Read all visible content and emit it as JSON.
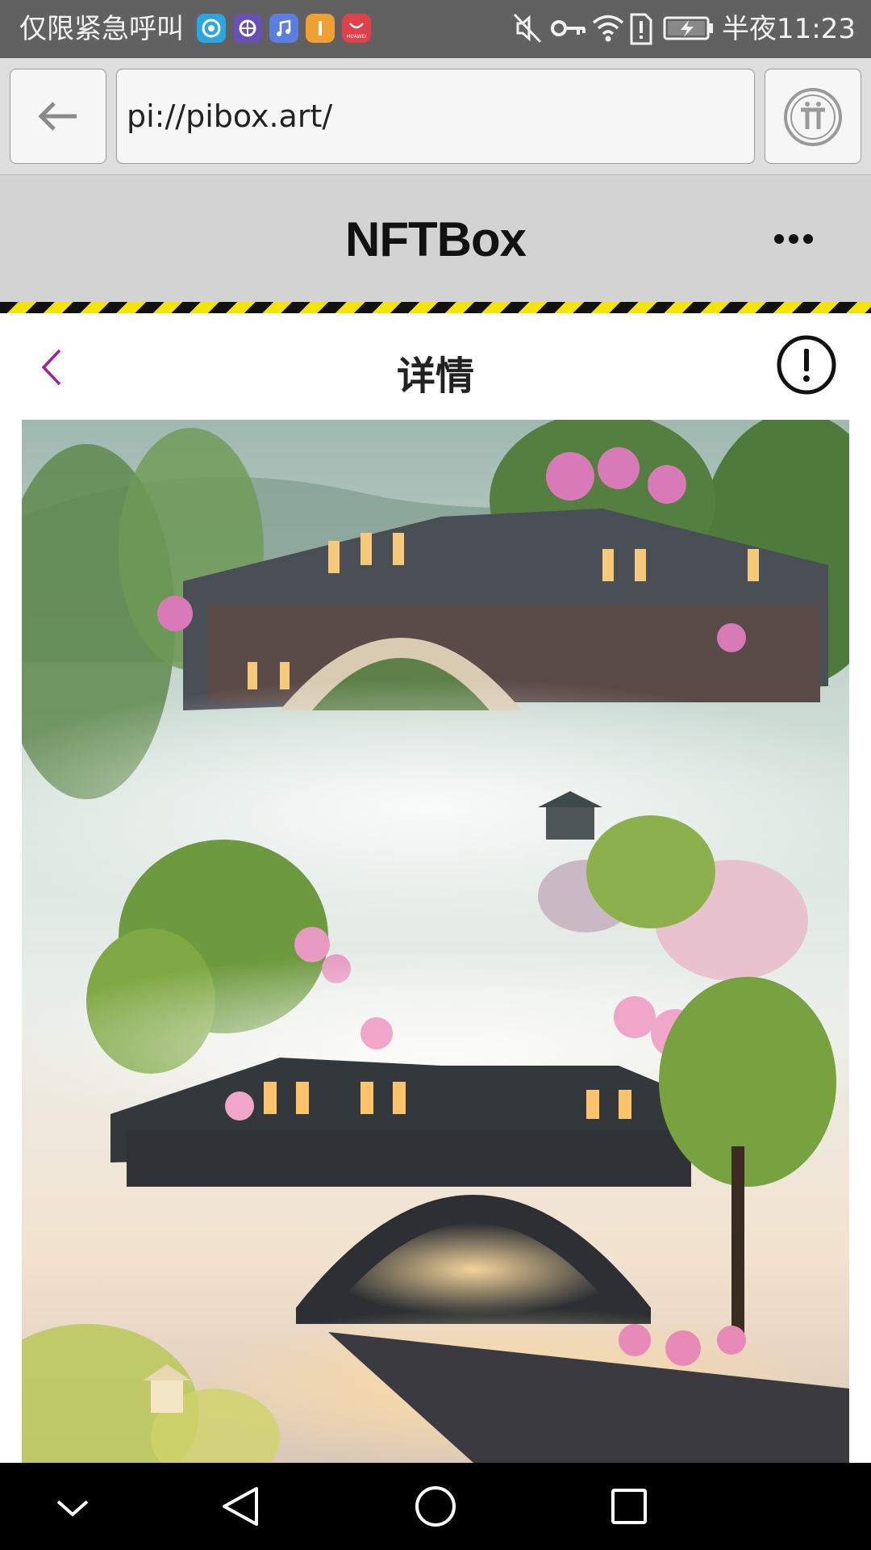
{
  "status_bar": {
    "carrier_text": "仅限紧急呼叫",
    "time": "半夜11:23",
    "app_icons": [
      "sina-weibo-icon",
      "purple-app-icon",
      "music-icon",
      "orange-app-icon",
      "huawei-store-icon"
    ],
    "status_icons": [
      "mute-icon",
      "key-icon",
      "wifi-icon",
      "sim-alert-icon",
      "battery-charging-icon"
    ],
    "huawei_label": "HUAWEI"
  },
  "browser": {
    "url": "pi://pibox.art/",
    "back_icon": "arrow-left-icon",
    "pi_icon": "pi-logo-icon"
  },
  "app_header": {
    "title": "NFTBox",
    "menu_icon": "more-horizontal-icon"
  },
  "detail": {
    "title": "详情",
    "back_icon": "chevron-left-icon",
    "info_icon": "exclamation-circle-icon",
    "accent_color": "#a020a0"
  },
  "artwork": {
    "description_icon": "nft-artwork-image"
  },
  "nav_bar": {
    "icons": [
      "chevron-down-icon",
      "back-triangle-icon",
      "home-circle-icon",
      "recents-square-icon"
    ]
  }
}
